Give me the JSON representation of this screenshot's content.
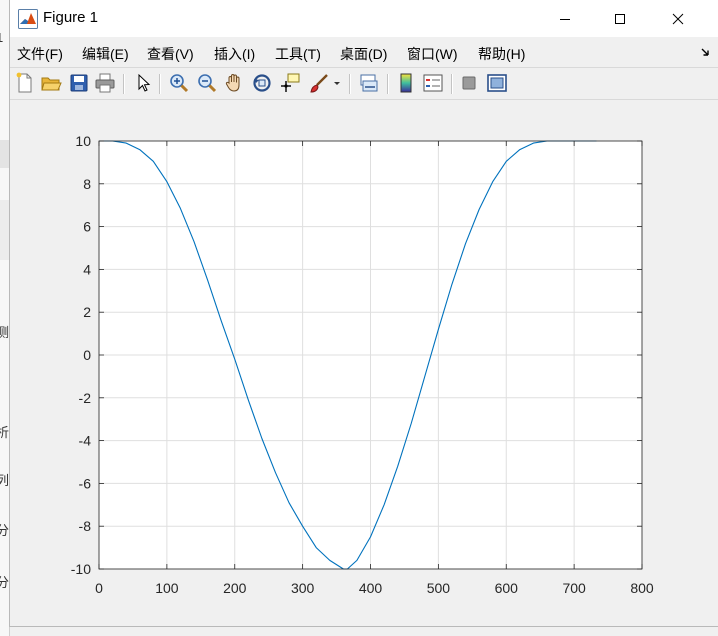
{
  "window": {
    "title": "Figure 1"
  },
  "background_fragments": [
    "1",
    "测",
    "析",
    "列",
    "分",
    "分"
  ],
  "menu": {
    "items": [
      {
        "id": "file",
        "label": "文件(F)"
      },
      {
        "id": "edit",
        "label": "编辑(E)"
      },
      {
        "id": "view",
        "label": "查看(V)"
      },
      {
        "id": "insert",
        "label": "插入(I)"
      },
      {
        "id": "tools",
        "label": "工具(T)"
      },
      {
        "id": "desktop",
        "label": "桌面(D)"
      },
      {
        "id": "window",
        "label": "窗口(W)"
      },
      {
        "id": "help",
        "label": "帮助(H)"
      }
    ]
  },
  "toolbar": {
    "buttons": [
      "new-figure",
      "open-file",
      "save",
      "print",
      "edit-plot-pointer",
      "zoom-in",
      "zoom-out",
      "pan",
      "rotate-3d",
      "data-cursor",
      "brush-data",
      "brush-dropdown",
      "link-plot",
      "insert-colorbar",
      "insert-legend",
      "hide-plot-tools",
      "show-plot-tools"
    ]
  },
  "colors": {
    "line": "#0072bd",
    "grid": "#dfdfdf",
    "axes_background": "#ffffff",
    "figure_background": "#f0f0f0"
  },
  "chart_data": {
    "type": "line",
    "title": "",
    "xlabel": "",
    "ylabel": "",
    "xlim": [
      0,
      800
    ],
    "ylim": [
      -10,
      10
    ],
    "xticks": [
      "0",
      "100",
      "200",
      "300",
      "400",
      "500",
      "600",
      "700",
      "800"
    ],
    "yticks": [
      "-10",
      "-8",
      "-6",
      "-4",
      "-2",
      "0",
      "2",
      "4",
      "6",
      "8",
      "10"
    ],
    "grid": true,
    "box": true,
    "series": [
      {
        "x": [
          0,
          20,
          40,
          60,
          80,
          100,
          120,
          140,
          160,
          180,
          200,
          220,
          240,
          260,
          280,
          300,
          320,
          340,
          360,
          366,
          380,
          400,
          420,
          440,
          460,
          480,
          500,
          520,
          540,
          560,
          580,
          600,
          620,
          640,
          660,
          680,
          700,
          720,
          733
        ],
        "y": [
          10.0,
          10.0,
          9.9,
          9.6,
          9.05,
          8.1,
          6.85,
          5.3,
          3.5,
          1.6,
          -0.2,
          -2.1,
          -3.9,
          -5.5,
          -6.9,
          -8.0,
          -9.0,
          -9.6,
          -10.0,
          -10.0,
          -9.6,
          -8.5,
          -7.0,
          -5.2,
          -3.2,
          -1.0,
          1.2,
          3.3,
          5.2,
          6.8,
          8.1,
          9.05,
          9.6,
          9.9,
          10.0,
          10.0,
          10.0,
          10.0,
          10.0
        ]
      }
    ]
  }
}
